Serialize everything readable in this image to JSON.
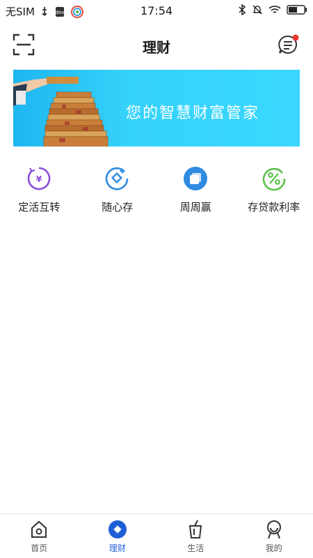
{
  "status_bar": {
    "carrier": "无SIM",
    "time": "17:54",
    "icons": [
      "usb-icon",
      "debug-icon",
      "app-notification-icon",
      "bluetooth-icon",
      "mute-icon",
      "wifi-icon",
      "battery-icon"
    ]
  },
  "header": {
    "title": "理财",
    "scan_icon": "scan-icon",
    "message_icon": "message-icon",
    "has_unread_dot": true
  },
  "banner": {
    "text": "您的智慧财富管家"
  },
  "quick_menu": [
    {
      "label": "定活互转",
      "icon": "yuan-transfer-icon",
      "color": "#8a4fd8"
    },
    {
      "label": "随心存",
      "icon": "deposit-icon",
      "color": "#2f8be0"
    },
    {
      "label": "周周赢",
      "icon": "weekly-win-icon",
      "color": "#2f8be0"
    },
    {
      "label": "存贷款利率",
      "icon": "percent-icon",
      "color": "#5cc24a"
    }
  ],
  "tab_bar": {
    "active_index": 1,
    "accent": "#1f5fd6",
    "items": [
      {
        "label": "首页",
        "icon": "home-icon"
      },
      {
        "label": "理财",
        "icon": "finance-icon"
      },
      {
        "label": "生活",
        "icon": "life-icon"
      },
      {
        "label": "我的",
        "icon": "profile-icon"
      }
    ]
  }
}
